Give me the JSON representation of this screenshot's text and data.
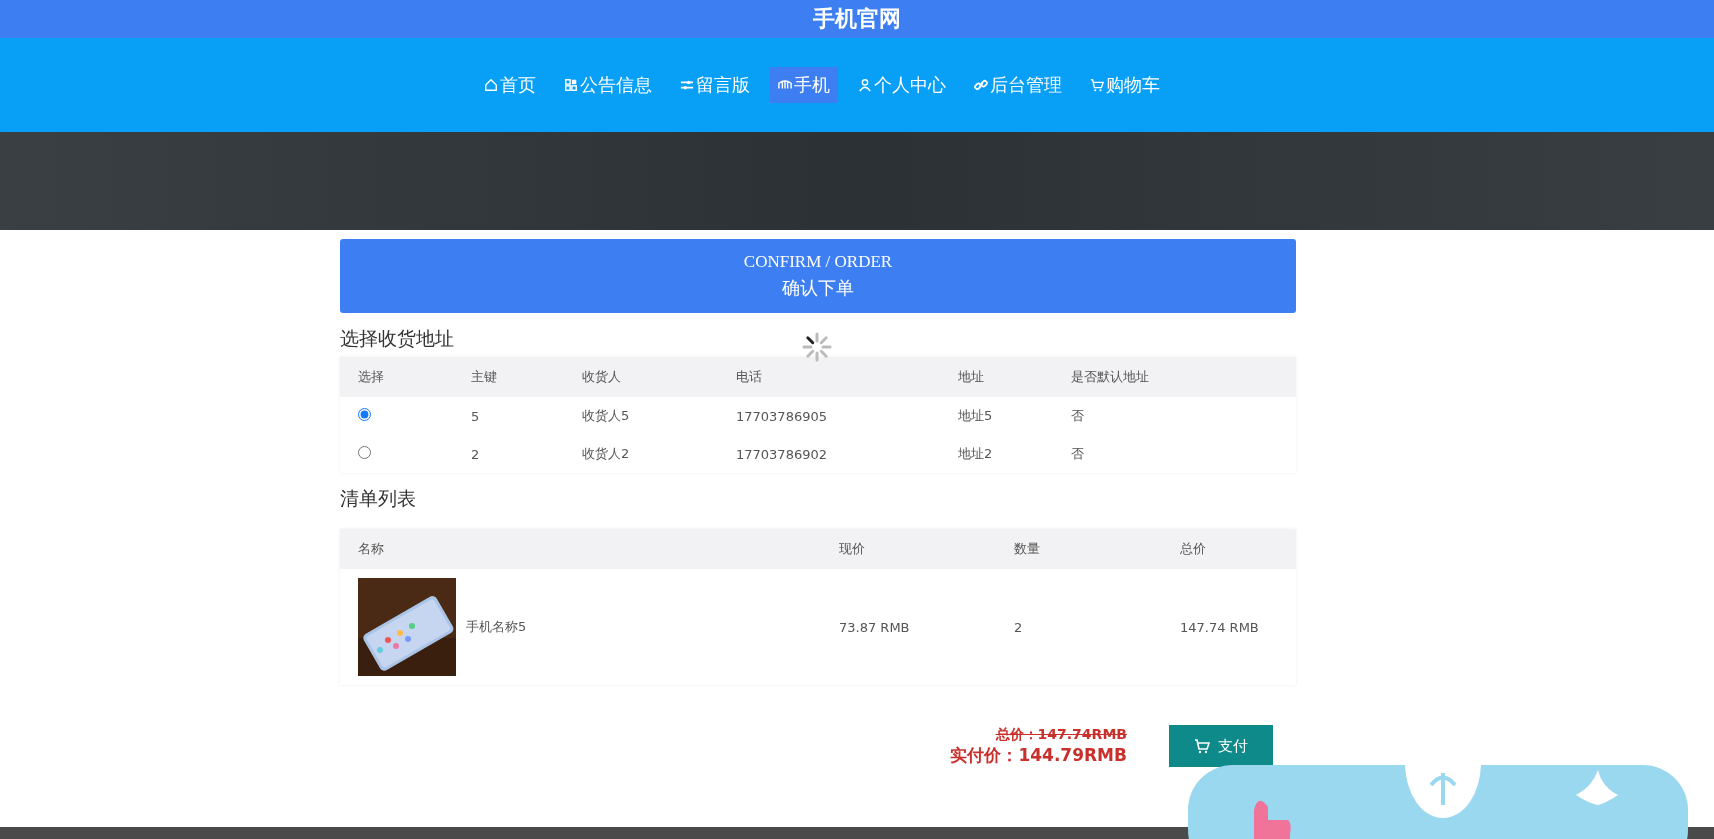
{
  "site_title": "手机官网",
  "nav": [
    {
      "label": "首页",
      "selected": false
    },
    {
      "label": "公告信息",
      "selected": false
    },
    {
      "label": "留言版",
      "selected": false
    },
    {
      "label": "手机",
      "selected": true
    },
    {
      "label": "个人中心",
      "selected": false
    },
    {
      "label": "后台管理",
      "selected": false
    },
    {
      "label": "购物车",
      "selected": false
    }
  ],
  "banner": {
    "title": "CONFIRM / ORDER",
    "subtitle": "确认下单"
  },
  "address_section": {
    "title": "选择收货地址",
    "columns": [
      "选择",
      "主键",
      "收货人",
      "电话",
      "地址",
      "是否默认地址"
    ],
    "rows": [
      {
        "selected": true,
        "key": "5",
        "recipient": "收货人5",
        "phone": "17703786905",
        "address": "地址5",
        "is_default": "否"
      },
      {
        "selected": false,
        "key": "2",
        "recipient": "收货人2",
        "phone": "17703786902",
        "address": "地址2",
        "is_default": "否"
      }
    ]
  },
  "items_section": {
    "title": "清单列表",
    "columns": [
      "名称",
      "现价",
      "数量",
      "总价"
    ],
    "rows": [
      {
        "name": "手机名称5",
        "price": "73.87 RMB",
        "quantity": "2",
        "total": "147.74 RMB"
      }
    ]
  },
  "summary": {
    "original_total": "总价：147.74RMB",
    "actual_total": "实付价：144.79RMB",
    "pay_button": "支付"
  }
}
